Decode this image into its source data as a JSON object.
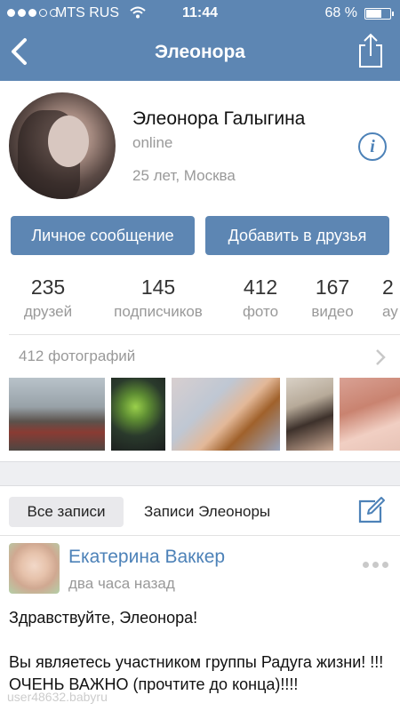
{
  "status_bar": {
    "carrier": "MTS RUS",
    "time": "11:44",
    "battery": "68 %",
    "battery_level": 0.68,
    "signal_bars_filled": 3,
    "signal_bars_total": 5
  },
  "nav": {
    "title": "Элеонора",
    "back_icon": "chevron-left-icon",
    "share_icon": "share-icon"
  },
  "profile": {
    "name": "Элеонора Галыгина",
    "status": "online",
    "age_city": "25 лет, Москва",
    "info_icon_glyph": "i"
  },
  "buttons": {
    "message": "Личное сообщение",
    "add_friend": "Добавить в друзья"
  },
  "counters": [
    {
      "value": "235",
      "label": "друзей"
    },
    {
      "value": "145",
      "label": "подписчиков"
    },
    {
      "value": "412",
      "label": "фото"
    },
    {
      "value": "167",
      "label": "видео"
    },
    {
      "value": "2",
      "label": "ау"
    }
  ],
  "photos": {
    "label": "412 фотографий"
  },
  "wall_tabs": {
    "all": "Все записи",
    "own": "Записи Элеоноры",
    "compose_icon": "compose-icon"
  },
  "post": {
    "author": "Екатерина Ваккер",
    "time": "два часа назад",
    "text": "Здравствуйте, Элеонора!\n\nВы являетесь участником группы Радуга жизни! !!!ОЧЕНЬ ВАЖНО (прочтите до конца)!!!!"
  },
  "watermark": "user48632.babyru",
  "colors": {
    "bar": "#5d86b3",
    "link": "#4d82b8",
    "muted": "#999999"
  }
}
